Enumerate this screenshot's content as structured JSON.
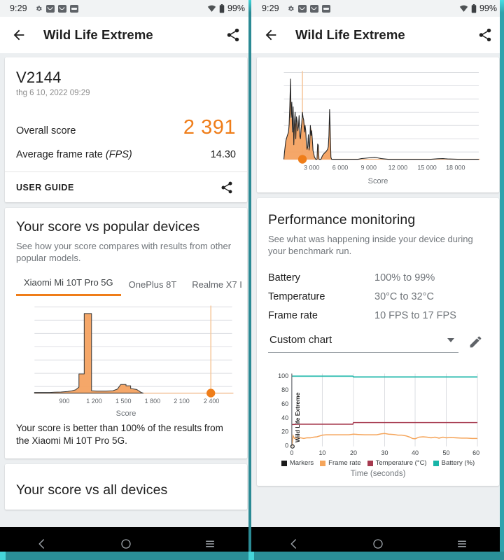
{
  "statusbar": {
    "time": "9:29",
    "battery": "99%",
    "icons": [
      "gear-icon",
      "mail-badge-icon",
      "mail-badge-icon",
      "vivo-badge-icon",
      "wifi-icon",
      "battery-icon"
    ]
  },
  "appbar": {
    "back": "back-arrow-icon",
    "title": "Wild Life Extreme",
    "share": "share-icon"
  },
  "left": {
    "score_card": {
      "device": "V2144",
      "date": "thg 6 10, 2022 09:29",
      "overall_label": "Overall score",
      "overall_value": "2 391",
      "fps_label": "Average frame rate",
      "fps_label_italic": "(FPS)",
      "fps_value": "14.30",
      "user_guide": "USER GUIDE"
    },
    "popular": {
      "title": "Your score vs popular devices",
      "subtitle": "See how your score compares with results from other popular models.",
      "tabs": [
        {
          "label": "Xiaomi Mi 10T Pro 5G",
          "active": true
        },
        {
          "label": "OnePlus 8T",
          "active": false
        },
        {
          "label": "Realme X7 I",
          "active": false
        }
      ],
      "note": "Your score is better than 100% of the results from the Xiaomi Mi 10T Pro 5G."
    },
    "all_devices": {
      "title": "Your score vs all devices"
    }
  },
  "right": {
    "perf": {
      "title": "Performance monitoring",
      "subtitle": "See what was happening inside your device during your benchmark run.",
      "rows": [
        {
          "key": "Battery",
          "value": "100% to 99%"
        },
        {
          "key": "Temperature",
          "value": "30°C to 32°C"
        },
        {
          "key": "Frame rate",
          "value": "10 FPS to 17 FPS"
        }
      ],
      "select_value": "Custom chart",
      "edit_icon": "pencil-icon"
    }
  },
  "navbar": {
    "back": "nav-back-icon",
    "home": "nav-home-icon",
    "recents": "nav-recents-icon"
  },
  "colors": {
    "accent_orange": "#ef7d19",
    "fill_orange": "#f6a05a",
    "teal": "#2a8f98",
    "frame_rate": "#f5a55b",
    "temperature": "#a63a4f",
    "battery": "#18b5a8",
    "markers": "#1a1a1a"
  },
  "chart_data": [
    {
      "id": "popular-devices-histogram",
      "type": "area",
      "title": "",
      "xlabel": "Score",
      "ylabel": "",
      "xlim": [
        600,
        2550
      ],
      "ylim": [
        0,
        100
      ],
      "grid": true,
      "xticks": [
        900,
        1200,
        1500,
        1800,
        2100,
        2400
      ],
      "xticklabels": [
        "900",
        "1 200",
        "1 500",
        "1 800",
        "2 100",
        "2 400"
      ],
      "marker": {
        "label": "Your score",
        "x": 2391,
        "y": 0,
        "color": "#ef7d19"
      },
      "x": [
        620,
        700,
        780,
        860,
        920,
        980,
        1030,
        1050,
        1075,
        1100,
        1130,
        1160,
        1200,
        1260,
        1320,
        1380,
        1420,
        1440,
        1470,
        1500,
        1530,
        1560,
        1600,
        1640,
        1700,
        1800,
        1900,
        2000,
        2100,
        2200,
        2300,
        2400,
        2500
      ],
      "y": [
        1,
        1,
        1.5,
        2,
        2,
        3,
        6,
        22,
        22,
        95,
        95,
        4,
        3,
        3,
        3,
        3,
        5,
        10,
        11,
        11,
        6,
        6,
        4,
        1,
        0,
        0,
        0,
        0,
        0,
        0,
        0,
        0,
        0
      ]
    },
    {
      "id": "all-devices-histogram",
      "type": "area",
      "title": "",
      "xlabel": "Score",
      "ylabel": "",
      "xlim": [
        0,
        20500
      ],
      "ylim": [
        0,
        100
      ],
      "grid": true,
      "xticks": [
        3000,
        6000,
        9000,
        12000,
        15000,
        18000
      ],
      "xticklabels": [
        "3 000",
        "6 000",
        "9 000",
        "12 000",
        "15 000",
        "18 000"
      ],
      "marker": {
        "label": "Your score",
        "x": 2391,
        "y": 0,
        "color": "#ef7d19"
      },
      "x": [
        200,
        400,
        600,
        800,
        900,
        1000,
        1100,
        1200,
        1300,
        1400,
        1500,
        1600,
        1700,
        1800,
        1900,
        2000,
        2100,
        2200,
        2400,
        2600,
        2800,
        3000,
        3200,
        3400,
        3600,
        3800,
        4000,
        4200,
        4400,
        4600,
        4800,
        5000,
        5200,
        5400,
        5600,
        6000,
        7000,
        8000,
        9000,
        9500,
        10000,
        10500,
        11000,
        12000,
        14000,
        16000,
        18000,
        19000,
        20500
      ],
      "y": [
        8,
        30,
        38,
        45,
        62,
        100,
        72,
        70,
        44,
        62,
        40,
        56,
        48,
        34,
        44,
        52,
        60,
        38,
        30,
        24,
        22,
        18,
        14,
        10,
        28,
        6,
        3,
        3,
        6,
        10,
        14,
        52,
        2,
        1,
        0.5,
        0,
        0,
        0,
        1.5,
        2,
        3,
        2.5,
        1.5,
        0,
        0,
        0.8,
        0.5,
        0,
        0
      ]
    },
    {
      "id": "custom-performance-chart",
      "type": "line",
      "title": "Custom chart",
      "xlabel": "Time (seconds)",
      "ylabel": "Wild Life Extreme",
      "xlim": [
        0,
        60
      ],
      "ylim": [
        0,
        105
      ],
      "yticks": [
        0,
        20,
        40,
        60,
        80,
        100
      ],
      "yticklabels": [
        "0",
        "20",
        "40",
        "60",
        "80",
        "100"
      ],
      "xticks": [
        0,
        10,
        20,
        30,
        40,
        50,
        60
      ],
      "xticklabels": [
        "0",
        "10",
        "20",
        "30",
        "40",
        "50",
        "60"
      ],
      "grid": true,
      "legend_position": "bottom",
      "series": [
        {
          "name": "Markers",
          "color": "#1a1a1a",
          "x": [
            0
          ],
          "y": [
            0
          ]
        },
        {
          "name": "Frame rate",
          "color": "#f5a55b",
          "x": [
            0,
            1,
            2,
            3,
            4,
            5,
            6,
            7,
            8,
            9,
            10,
            11,
            12,
            13,
            14,
            15,
            16,
            17,
            18,
            19,
            20,
            21,
            22,
            23,
            24,
            25,
            26,
            27,
            28,
            29,
            30,
            31,
            32,
            33,
            34,
            35,
            36,
            37,
            38,
            39,
            40,
            41,
            42,
            43,
            44,
            45,
            46,
            47,
            48,
            49,
            50,
            51,
            52,
            53,
            54,
            55,
            56,
            57,
            58,
            59,
            60
          ],
          "y": [
            0,
            14,
            11,
            12,
            12,
            12,
            11,
            12,
            12,
            12,
            12,
            13,
            15,
            15,
            15,
            15,
            15,
            15,
            15,
            15,
            16,
            16,
            16,
            15,
            15,
            15,
            15,
            15,
            15,
            16,
            16,
            15,
            17,
            16,
            16,
            15,
            15,
            15,
            14,
            14,
            14,
            12,
            11,
            11,
            14,
            14,
            14,
            14,
            13,
            12,
            12,
            13,
            12,
            11,
            13,
            12,
            12,
            12,
            12,
            11,
            11
          ]
        },
        {
          "name": "Temperature (°C)",
          "color": "#a63a4f",
          "x": [
            0,
            5,
            10,
            15,
            19,
            20,
            30,
            40,
            50,
            60
          ],
          "y": [
            29,
            30,
            30,
            30,
            30,
            32,
            32,
            32,
            32,
            32
          ]
        },
        {
          "name": "Battery (%)",
          "color": "#18b5a8",
          "x": [
            0,
            5,
            10,
            15,
            19,
            20,
            30,
            40,
            50,
            60
          ],
          "y": [
            100,
            100,
            100,
            100,
            100,
            99,
            99,
            99,
            99,
            99
          ]
        }
      ]
    }
  ]
}
